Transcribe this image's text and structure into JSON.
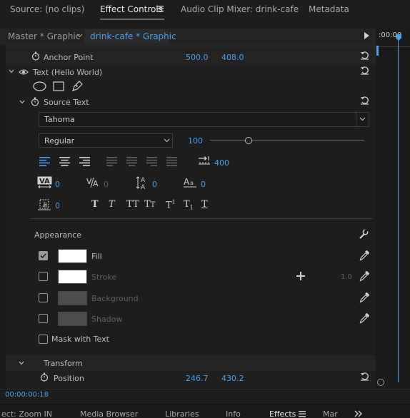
{
  "tabs": {
    "source": "Source: (no clips)",
    "effect_controls": "Effect Controls",
    "audio_mixer": "Audio Clip Mixer: drink-cafe",
    "metadata": "Metadata"
  },
  "subheader": {
    "master": "Master * Graphic",
    "clip": "drink-cafe * Graphic",
    "timecode_ruler": ":00:00"
  },
  "anchor_point": {
    "label": "Anchor Point",
    "x": "500.0",
    "y": "408.0"
  },
  "text_layer": {
    "label": "Text (Hello World)"
  },
  "source_text": {
    "label": "Source Text",
    "font": "Tahoma",
    "style": "Regular",
    "size": "100",
    "tab_width": "400",
    "kerning": "0",
    "tracking": "0",
    "leading": "0",
    "baseline": "0",
    "tsume": "0"
  },
  "appearance": {
    "label": "Appearance",
    "fill": "Fill",
    "stroke": "Stroke",
    "stroke_width": "1.0",
    "background": "Background",
    "shadow": "Shadow",
    "mask": "Mask with Text",
    "fill_color": "#ffffff"
  },
  "transform": {
    "label": "Transform"
  },
  "position": {
    "label": "Position",
    "x": "246.7",
    "y": "430.2"
  },
  "current_time": "00:00:00:18",
  "bottom_tabs": {
    "effect": "ect: Zoom IN",
    "media_browser": "Media Browser",
    "libraries": "Libraries",
    "info": "Info",
    "effects": "Effects",
    "markers": "Mar"
  }
}
